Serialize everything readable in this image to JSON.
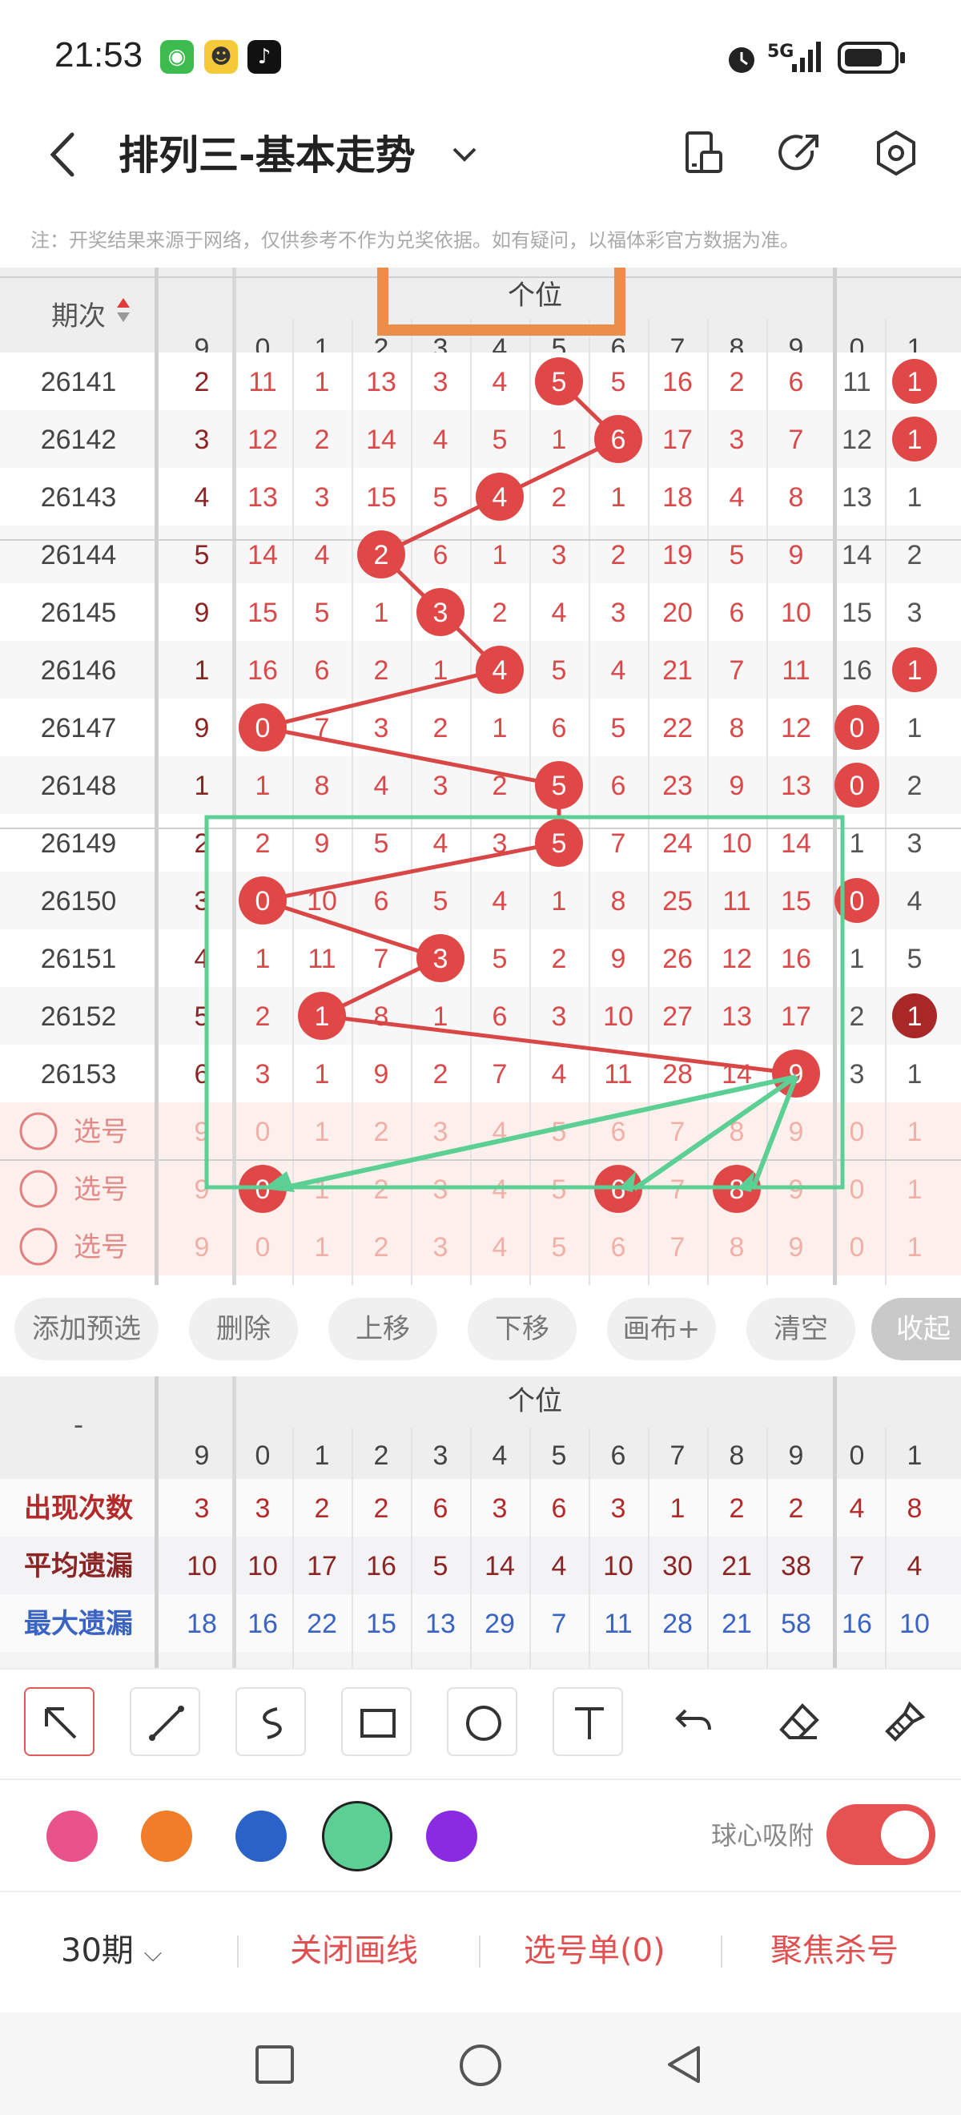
{
  "status": {
    "time": "21:53",
    "network": "5G"
  },
  "header": {
    "title": "排列三-基本走势"
  },
  "notice": "注：开奖结果来源于网络，仅供参考不作为兑奖依据。如有疑问，以福体彩官方数据为准。",
  "grid": {
    "period_header": "期次",
    "section_title": "个位",
    "columns": [
      "9",
      "0",
      "1",
      "2",
      "3",
      "4",
      "5",
      "6",
      "7",
      "8",
      "9",
      "0",
      "1"
    ],
    "rows": [
      {
        "period": "26141",
        "cells": [
          "2",
          "11",
          "1",
          "13",
          "3",
          "4",
          "5",
          "5",
          "16",
          "2",
          "6",
          "11",
          "1"
        ],
        "hit": 6,
        "extra_hit": 12
      },
      {
        "period": "26142",
        "cells": [
          "3",
          "12",
          "2",
          "14",
          "4",
          "5",
          "1",
          "6",
          "17",
          "3",
          "7",
          "12",
          "1"
        ],
        "hit": 7,
        "extra_hit": 12
      },
      {
        "period": "26143",
        "cells": [
          "4",
          "13",
          "3",
          "15",
          "5",
          "4",
          "2",
          "1",
          "18",
          "4",
          "8",
          "13",
          "1"
        ],
        "hit": 5,
        "extra_hit": null
      },
      {
        "period": "26144",
        "cells": [
          "5",
          "14",
          "4",
          "2",
          "6",
          "1",
          "3",
          "2",
          "19",
          "5",
          "9",
          "14",
          "2"
        ],
        "hit": 3,
        "extra_hit": null
      },
      {
        "period": "26145",
        "cells": [
          "9",
          "15",
          "5",
          "1",
          "3",
          "2",
          "4",
          "3",
          "20",
          "6",
          "10",
          "15",
          "3"
        ],
        "hit": 4,
        "extra_hit": null,
        "left_hit": true
      },
      {
        "period": "26146",
        "cells": [
          "1",
          "16",
          "6",
          "2",
          "1",
          "4",
          "5",
          "4",
          "21",
          "7",
          "11",
          "16",
          "1"
        ],
        "hit": 5,
        "extra_hit": 12
      },
      {
        "period": "26147",
        "cells": [
          "9",
          "0",
          "7",
          "3",
          "2",
          "1",
          "6",
          "5",
          "22",
          "8",
          "12",
          "0",
          "1"
        ],
        "hit": 1,
        "extra_hit": 11,
        "left_hit": true
      },
      {
        "period": "26148",
        "cells": [
          "1",
          "1",
          "8",
          "4",
          "3",
          "2",
          "5",
          "6",
          "23",
          "9",
          "13",
          "0",
          "2"
        ],
        "hit": 6,
        "extra_hit": 11
      },
      {
        "period": "26149",
        "cells": [
          "2",
          "2",
          "9",
          "5",
          "4",
          "3",
          "5",
          "7",
          "24",
          "10",
          "14",
          "1",
          "3"
        ],
        "hit": 6,
        "extra_hit": null
      },
      {
        "period": "26150",
        "cells": [
          "3",
          "0",
          "10",
          "6",
          "5",
          "4",
          "1",
          "8",
          "25",
          "11",
          "15",
          "0",
          "4"
        ],
        "hit": 1,
        "extra_hit": 11
      },
      {
        "period": "26151",
        "cells": [
          "4",
          "1",
          "11",
          "7",
          "3",
          "5",
          "2",
          "9",
          "26",
          "12",
          "16",
          "1",
          "5"
        ],
        "hit": 4,
        "extra_hit": null
      },
      {
        "period": "26152",
        "cells": [
          "5",
          "2",
          "1",
          "8",
          "1",
          "6",
          "3",
          "10",
          "27",
          "13",
          "17",
          "2",
          "1"
        ],
        "hit": 2,
        "extra_hit": 12,
        "dark_extra": true
      },
      {
        "period": "26153",
        "cells": [
          "6",
          "3",
          "1",
          "9",
          "2",
          "7",
          "4",
          "11",
          "28",
          "14",
          "9",
          "3",
          "1"
        ],
        "hit": 10,
        "extra_hit": null
      }
    ],
    "pick_label": "选号",
    "pick_rows": [
      {
        "cells": [
          "9",
          "0",
          "1",
          "2",
          "3",
          "4",
          "5",
          "6",
          "7",
          "8",
          "9",
          "0",
          "1"
        ],
        "picked": []
      },
      {
        "cells": [
          "9",
          "0",
          "1",
          "2",
          "3",
          "4",
          "5",
          "6",
          "7",
          "8",
          "9",
          "0",
          "1"
        ],
        "picked": [
          1,
          7,
          9
        ]
      },
      {
        "cells": [
          "9",
          "0",
          "1",
          "2",
          "3",
          "4",
          "5",
          "6",
          "7",
          "8",
          "9",
          "0",
          "1"
        ],
        "picked": []
      }
    ]
  },
  "actions": {
    "add": "添加预选",
    "delete": "删除",
    "up": "上移",
    "down": "下移",
    "canvas": "画布+",
    "clear": "清空",
    "collapse": "收起"
  },
  "stats": {
    "dash": "-",
    "section_title": "个位",
    "columns": [
      "9",
      "0",
      "1",
      "2",
      "3",
      "4",
      "5",
      "6",
      "7",
      "8",
      "9",
      "0",
      "1"
    ],
    "rows": [
      {
        "label": "出现次数",
        "values": [
          "3",
          "3",
          "2",
          "2",
          "6",
          "3",
          "6",
          "3",
          "1",
          "2",
          "2",
          "4",
          "8"
        ],
        "color": "#b22a2a"
      },
      {
        "label": "平均遗漏",
        "values": [
          "10",
          "10",
          "17",
          "16",
          "5",
          "14",
          "4",
          "10",
          "30",
          "21",
          "38",
          "7",
          "4"
        ],
        "color": "#8b2525"
      },
      {
        "label": "最大遗漏",
        "values": [
          "18",
          "16",
          "22",
          "15",
          "13",
          "29",
          "7",
          "11",
          "28",
          "21",
          "58",
          "16",
          "10"
        ],
        "color": "#3a63c4"
      }
    ]
  },
  "tools": [
    "select-arrow",
    "line",
    "curve",
    "rectangle",
    "circle",
    "text",
    "undo",
    "eraser",
    "clear-brush"
  ],
  "colors": [
    "#e9528a",
    "#ef7d2a",
    "#2a62c7",
    "#5ccf94",
    "#8a2be2"
  ],
  "snap": {
    "label": "球心吸附",
    "on": true
  },
  "bottom": {
    "period": "30期",
    "close_draw": "关闭画线",
    "pick_list": "选号单(0)",
    "focus_kill": "聚焦杀号"
  }
}
